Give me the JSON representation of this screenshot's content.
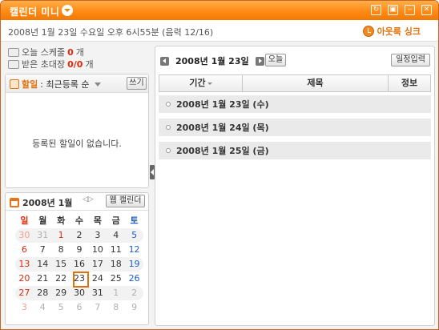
{
  "window": {
    "title": "캘린더 미니"
  },
  "titlebar": {
    "icons": [
      "refresh-icon",
      "window-icon",
      "minimize-icon",
      "close-icon"
    ],
    "icon_glyphs": [
      "↻",
      "▣",
      "‒",
      "✕"
    ]
  },
  "header": {
    "datetime": "2008년 1월 23일 수요일 오후 6시55분 (음력 12/16)",
    "sync_label": "아웃룩 싱크"
  },
  "status": {
    "schedule_prefix": "오늘 스케줄",
    "schedule_count": "0",
    "schedule_suffix": "개",
    "invite_prefix": "받은 초대장",
    "invite_count": "0/0",
    "invite_suffix": "개"
  },
  "todo": {
    "label": "할일",
    "sort_label": ": 최근등록 순",
    "write_button": "쓰기",
    "empty_message": "등록된 할일이 없습니다."
  },
  "mini_calendar": {
    "month_label": "2008년 1월",
    "arrows": "◁▷",
    "web_calendar_button": "웹 캘린더",
    "weekdays": [
      "일",
      "월",
      "화",
      "수",
      "목",
      "금",
      "토"
    ],
    "weeks": [
      [
        "30",
        "31",
        "1",
        "2",
        "3",
        "4",
        "5"
      ],
      [
        "6",
        "7",
        "8",
        "9",
        "10",
        "11",
        "12"
      ],
      [
        "13",
        "14",
        "15",
        "16",
        "17",
        "18",
        "19"
      ],
      [
        "20",
        "21",
        "22",
        "23",
        "24",
        "25",
        "26"
      ],
      [
        "27",
        "28",
        "29",
        "30",
        "31",
        "1",
        "2"
      ],
      [
        "3",
        "4",
        "5",
        "6",
        "7",
        "8",
        "9"
      ]
    ],
    "today": "23"
  },
  "schedule": {
    "current_date": "2008년 1월 23일",
    "today_button": "오늘",
    "add_button": "일정입력",
    "columns": [
      "기간",
      "제목",
      "정보"
    ],
    "days": [
      "2008년 1월 23일 (수)",
      "2008년 1월 24일 (목)",
      "2008년 1월 25일 (금)"
    ]
  },
  "colors": {
    "accent": "#ff8a14",
    "holiday": "#e0280a",
    "saturday": "#1c5fc8"
  }
}
